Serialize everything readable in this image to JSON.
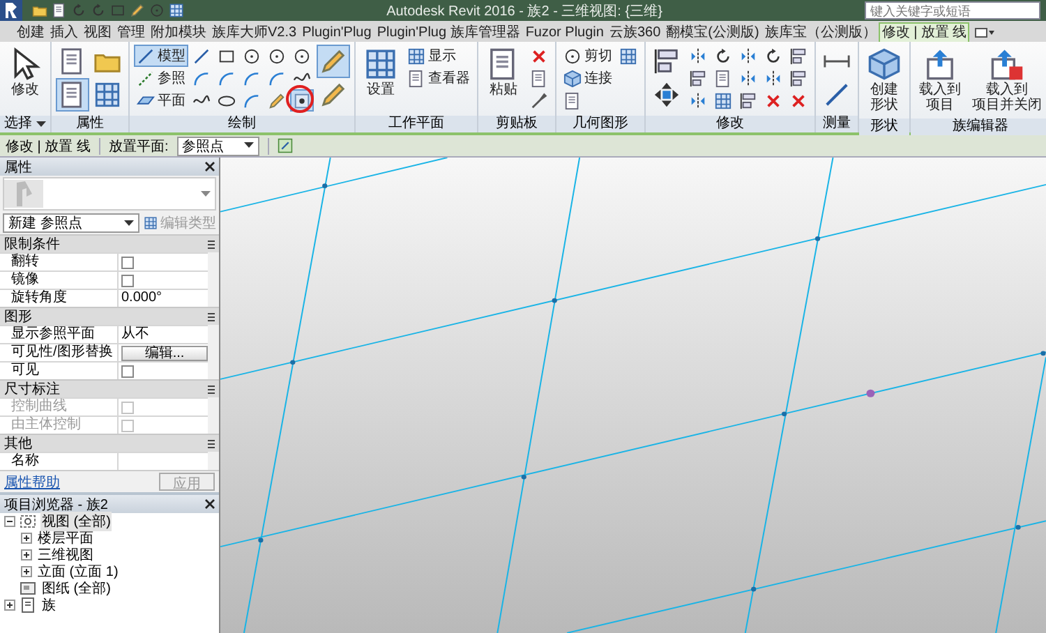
{
  "window": {
    "title": "Autodesk Revit 2016 - 族2 - 三维视图: {三维}",
    "search": {
      "placeholder": "键入关键字或短语"
    }
  },
  "tabs": [
    {
      "label": "创建",
      "selected": false
    },
    {
      "label": "插入",
      "selected": false
    },
    {
      "label": "视图",
      "selected": false
    },
    {
      "label": "管理",
      "selected": false
    },
    {
      "label": "附加模块",
      "selected": false
    },
    {
      "label": "族库大师V2.3",
      "selected": false
    },
    {
      "label": "Plugin'Plug",
      "selected": false
    },
    {
      "label": "Plugin'Plug 族库管理器",
      "selected": false
    },
    {
      "label": "Fuzor Plugin",
      "selected": false
    },
    {
      "label": "云族360",
      "selected": false
    },
    {
      "label": "翻模宝(公测版)",
      "selected": false
    },
    {
      "label": "族库宝（公测版）",
      "selected": false
    },
    {
      "label": "修改 | 放置 线",
      "selected": true
    }
  ],
  "ribbon": {
    "panels": [
      {
        "label": "选择",
        "menu": true,
        "tools": [
          {
            "kind": "large",
            "label": "修改",
            "selected": false,
            "circled": false
          }
        ]
      },
      {
        "label": "属性",
        "menu": false,
        "tools": [
          {
            "kind": "medium",
            "selected": false,
            "circled": false
          },
          {
            "kind": "medium",
            "selected": true,
            "circled": false
          },
          {
            "kind": "medium",
            "selected": false,
            "circled": false
          },
          {
            "kind": "medium",
            "selected": false,
            "circled": false
          }
        ]
      },
      {
        "label": "绘制",
        "menu": false,
        "tools": [
          {
            "kind": "small",
            "label": "模型",
            "selected": true,
            "circled": false
          },
          {
            "kind": "small",
            "label": "参照",
            "selected": false,
            "circled": false
          },
          {
            "kind": "small",
            "label": "平面",
            "selected": false,
            "circled": false
          },
          {
            "kind": "icon",
            "selected": false,
            "circled": false
          },
          {
            "kind": "icon",
            "selected": false,
            "circled": false
          },
          {
            "kind": "icon",
            "selected": false,
            "circled": false
          },
          {
            "kind": "icon",
            "selected": false,
            "circled": false
          },
          {
            "kind": "icon",
            "selected": false,
            "circled": false
          },
          {
            "kind": "icon",
            "selected": false,
            "circled": false
          },
          {
            "kind": "icon",
            "selected": false,
            "circled": false
          },
          {
            "kind": "icon",
            "selected": false,
            "circled": false
          },
          {
            "kind": "icon",
            "selected": false,
            "circled": false
          },
          {
            "kind": "icon",
            "selected": false,
            "circled": false
          },
          {
            "kind": "icon",
            "selected": false,
            "circled": false
          },
          {
            "kind": "icon",
            "selected": false,
            "circled": false
          },
          {
            "kind": "icon",
            "selected": false,
            "circled": false
          },
          {
            "kind": "icon",
            "selected": false,
            "circled": false
          },
          {
            "kind": "icon",
            "selected": true,
            "circled": true
          },
          {
            "kind": "medium",
            "selected": true,
            "circled": false
          },
          {
            "kind": "medium",
            "selected": false,
            "circled": false
          }
        ]
      },
      {
        "label": "工作平面",
        "menu": false,
        "tools": [
          {
            "kind": "large",
            "label": "设置",
            "selected": false,
            "circled": false
          },
          {
            "kind": "small",
            "label": "显示",
            "selected": false,
            "circled": false
          },
          {
            "kind": "small",
            "label": "查看器",
            "selected": false,
            "circled": false
          }
        ]
      },
      {
        "label": "剪贴板",
        "menu": false,
        "tools": [
          {
            "kind": "large",
            "label": "粘贴",
            "selected": false,
            "circled": false
          },
          {
            "kind": "icon",
            "selected": false,
            "circled": false
          },
          {
            "kind": "icon",
            "selected": false,
            "circled": false
          },
          {
            "kind": "icon",
            "selected": false,
            "circled": false
          }
        ]
      },
      {
        "label": "几何图形",
        "menu": false,
        "tools": [
          {
            "kind": "small",
            "label": "剪切",
            "selected": false,
            "circled": false
          },
          {
            "kind": "small",
            "label": "连接",
            "selected": false,
            "circled": false
          },
          {
            "kind": "icon",
            "selected": false,
            "circled": false
          },
          {
            "kind": "icon",
            "selected": false,
            "circled": false
          }
        ]
      },
      {
        "label": "修改",
        "menu": false,
        "tools": [
          {
            "kind": "medium",
            "selected": false,
            "circled": false
          },
          {
            "kind": "medium",
            "selected": false,
            "circled": false
          },
          {
            "kind": "icon",
            "selected": false,
            "circled": false
          },
          {
            "kind": "icon",
            "selected": false,
            "circled": false
          },
          {
            "kind": "icon",
            "selected": false,
            "circled": false
          },
          {
            "kind": "icon",
            "selected": false,
            "circled": false
          },
          {
            "kind": "icon",
            "selected": false,
            "circled": false
          },
          {
            "kind": "icon",
            "selected": false,
            "circled": false
          },
          {
            "kind": "icon",
            "selected": false,
            "circled": false
          },
          {
            "kind": "icon",
            "selected": false,
            "circled": false
          },
          {
            "kind": "icon",
            "selected": false,
            "circled": false
          },
          {
            "kind": "icon",
            "selected": false,
            "circled": false
          },
          {
            "kind": "icon",
            "selected": false,
            "circled": false
          },
          {
            "kind": "icon",
            "selected": false,
            "circled": false
          },
          {
            "kind": "icon",
            "selected": false,
            "circled": false
          },
          {
            "kind": "icon",
            "selected": false,
            "circled": false
          },
          {
            "kind": "icon",
            "selected": false,
            "circled": false
          }
        ]
      },
      {
        "label": "测量",
        "menu": false,
        "tools": [
          {
            "kind": "medium",
            "selected": false,
            "circled": false
          },
          {
            "kind": "medium",
            "selected": false,
            "circled": false
          }
        ]
      },
      {
        "label": "形状",
        "menu": false,
        "tools": [
          {
            "kind": "large",
            "label_lines": [
              "创建",
              "形状"
            ],
            "selected": false,
            "circled": false
          }
        ]
      },
      {
        "label": "族编辑器",
        "menu": false,
        "tools": [
          {
            "kind": "large",
            "label_lines": [
              "载入到",
              "项目"
            ],
            "selected": false,
            "circled": false
          },
          {
            "kind": "large",
            "label_lines": [
              "载入到",
              "项目并关闭"
            ],
            "selected": false,
            "circled": false
          }
        ]
      }
    ]
  },
  "options_bar": {
    "context": "修改 | 放置 线",
    "placement_label": "放置平面:",
    "placement_value": "参照点"
  },
  "properties": {
    "title": "属性",
    "type_selector": "新建 参照点",
    "edit_type": {
      "label": "编辑类型",
      "disabled": true
    },
    "groups": [
      {
        "label": "限制条件",
        "rows": [
          {
            "kind": "checkbox",
            "label": "翻转",
            "checked": false,
            "disabled": false
          },
          {
            "kind": "checkbox",
            "label": "镜像",
            "checked": false,
            "disabled": false
          },
          {
            "kind": "text",
            "label": "旋转角度",
            "value": "0.000°"
          }
        ]
      },
      {
        "label": "图形",
        "rows": [
          {
            "kind": "text",
            "label": "显示参照平面",
            "value": "从不"
          },
          {
            "kind": "button",
            "label": "可见性/图形替换",
            "value": "编辑..."
          },
          {
            "kind": "checkbox",
            "label": "可见",
            "checked": false,
            "disabled": false
          }
        ]
      },
      {
        "label": "尺寸标注",
        "rows": [
          {
            "kind": "checkbox",
            "label": "控制曲线",
            "checked": false,
            "disabled": true
          },
          {
            "kind": "checkbox",
            "label": "由主体控制",
            "checked": false,
            "disabled": true
          }
        ]
      },
      {
        "label": "其他",
        "rows": [
          {
            "kind": "text",
            "label": "名称"
          }
        ]
      }
    ],
    "help_link": "属性帮助",
    "apply": {
      "label": "应用",
      "disabled": true
    }
  },
  "project_browser": {
    "title": "项目浏览器 - 族2",
    "tree": [
      {
        "kind": "views",
        "label": "视图 (全部)",
        "selected": true,
        "expanded": true,
        "children": [
          {
            "label": "楼层平面",
            "selected": false,
            "expanded": false
          },
          {
            "label": "三维视图",
            "selected": false,
            "expanded": false
          },
          {
            "label": "立面 (立面 1)",
            "selected": false,
            "expanded": false
          }
        ]
      },
      {
        "kind": "sheets",
        "label": "图纸 (全部)",
        "selected": false
      },
      {
        "kind": "families",
        "label": "族",
        "selected": false,
        "expanded": false
      }
    ]
  }
}
